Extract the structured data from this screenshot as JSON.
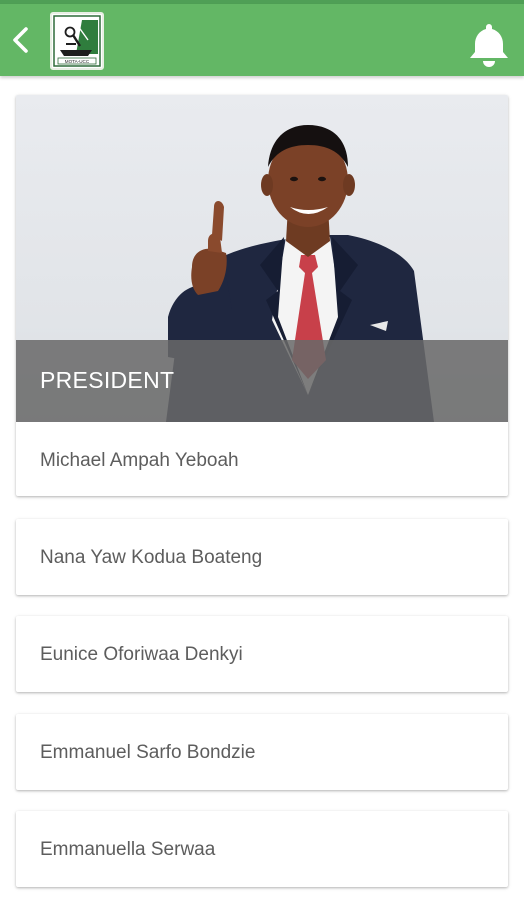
{
  "colors": {
    "app_bar": "#63b765",
    "hero_overlay": "#696969",
    "name_text": "#5d5d5d"
  },
  "header": {
    "back_icon": "chevron-left-icon",
    "logo_icon": "association-logo",
    "logo_text": "MOTA-UCC",
    "notification_icon": "bell-icon"
  },
  "featured": {
    "role": "PRESIDENT",
    "name": "Michael Ampah Yeboah"
  },
  "members": [
    {
      "name": "Nana Yaw Kodua Boateng"
    },
    {
      "name": "Eunice Oforiwaa Denkyi"
    },
    {
      "name": "Emmanuel Sarfo Bondzie"
    },
    {
      "name": "Emmanuella Serwaa"
    }
  ]
}
